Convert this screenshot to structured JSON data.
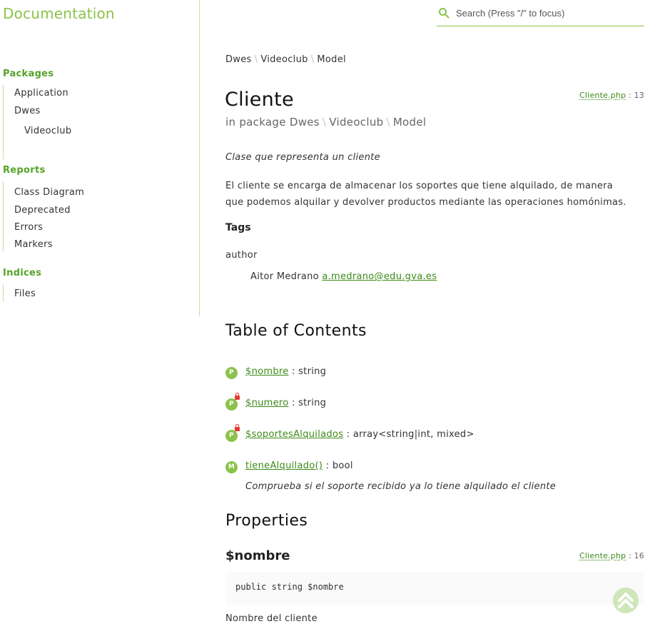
{
  "header": {
    "brand": "Documentation",
    "search_placeholder": "Search (Press \"/\" to focus)"
  },
  "sidebar": {
    "packages": {
      "heading": "Packages",
      "items": [
        "Application",
        "Dwes",
        "Videoclub"
      ]
    },
    "reports": {
      "heading": "Reports",
      "items": [
        "Class Diagram",
        "Deprecated",
        "Errors",
        "Markers"
      ]
    },
    "indices": {
      "heading": "Indices",
      "items": [
        "Files"
      ]
    }
  },
  "breadcrumb": [
    "Dwes",
    "Videoclub",
    "Model"
  ],
  "class": {
    "name": "Cliente",
    "package_prefix": "in package",
    "package_path": [
      "Dwes",
      "Videoclub",
      "Model"
    ],
    "file": "Cliente.php",
    "line": ": 13",
    "summary": "Clase que representa un cliente",
    "description": "El cliente se encarga de almacenar los soportes que tiene alquilado, de manera que podemos alquilar y devolver productos mediante las operaciones homónimas.",
    "tags_heading": "Tags",
    "tag_name": "author",
    "tag_author": "Aitor Medrano",
    "tag_email": "a.medrano@edu.gva.es"
  },
  "toc": {
    "heading": "Table of Contents",
    "items": [
      {
        "badge": "P",
        "name": "$nombre",
        "type": ": string",
        "private": false
      },
      {
        "badge": "P",
        "name": "$numero",
        "type": ": string",
        "private": true
      },
      {
        "badge": "P",
        "name": "$soportesAlquilados",
        "type": ": array<string|int, mixed>",
        "private": true
      },
      {
        "badge": "M",
        "name": "tieneAlquilado()",
        "type": ": bool",
        "private": false
      }
    ],
    "method_description": "Comprueba si el soporte recibido ya lo tiene alquilado el cliente"
  },
  "properties": {
    "heading": "Properties",
    "first": {
      "name": "$nombre",
      "file": "Cliente.php",
      "line": ": 16",
      "signature": "public string $nombre",
      "description": "Nombre del cliente"
    }
  },
  "colors": {
    "accent": "#8bc34a",
    "link": "#3c8a17",
    "private_lock": "#e53935"
  },
  "icons": {
    "search": "search-icon",
    "back_to_top": "chevron-up-icon"
  }
}
